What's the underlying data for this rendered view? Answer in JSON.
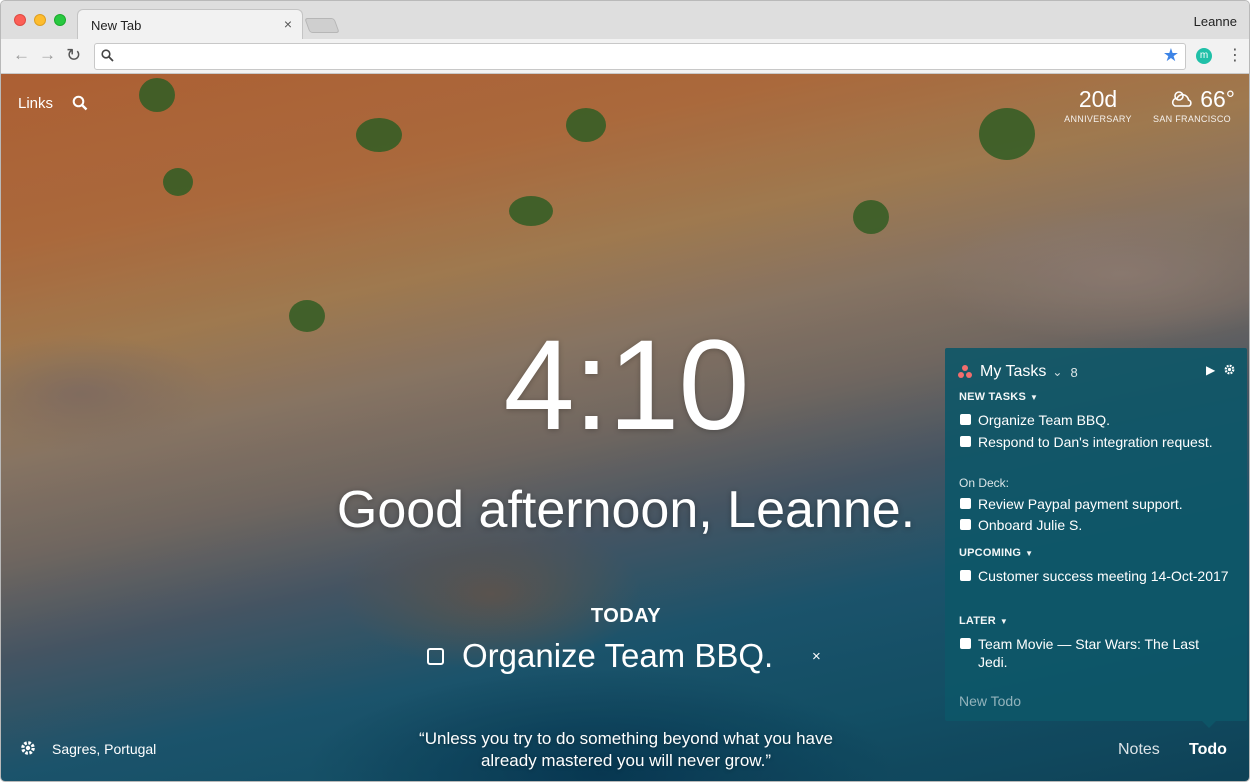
{
  "browser": {
    "tab_title": "New Tab",
    "tab_close": "×",
    "profile_name": "Leanne",
    "address_value": "",
    "ext_initial": "m"
  },
  "links": {
    "label": "Links"
  },
  "anniversary": {
    "value": "20d",
    "label": "ANNIVERSARY"
  },
  "weather": {
    "temp": "66°",
    "location": "SAN FRANCISCO"
  },
  "clock": "4:10",
  "greeting": "Good afternoon, Leanne.",
  "focus": {
    "label": "TODAY",
    "text": "Organize Team BBQ.",
    "close": "×"
  },
  "quote": "“Unless you try to do something beyond what you have already mastered you will never grow.”",
  "background_location": "Sagres, Portugal",
  "bottom_nav": {
    "notes": "Notes",
    "todo": "Todo"
  },
  "todo_panel": {
    "list_name": "My Tasks",
    "count": "8",
    "sections": {
      "new_tasks": "NEW TASKS",
      "on_deck": "On Deck:",
      "upcoming": "UPCOMING",
      "later": "LATER"
    },
    "tasks": [
      "Organize Team BBQ.",
      "Respond to Dan's integration request.",
      "Review Paypal payment support.",
      "Onboard Julie S.",
      "Customer success meeting 14-Oct-2017",
      "Team Movie — Star Wars: The Last Jedi."
    ],
    "new_todo_placeholder": "New Todo"
  },
  "colors": {
    "panel_bg": "#0d5668",
    "asana_accent": "#f26d6d",
    "bookmark_star": "#3d84e6",
    "extension": "#20c0a8"
  }
}
